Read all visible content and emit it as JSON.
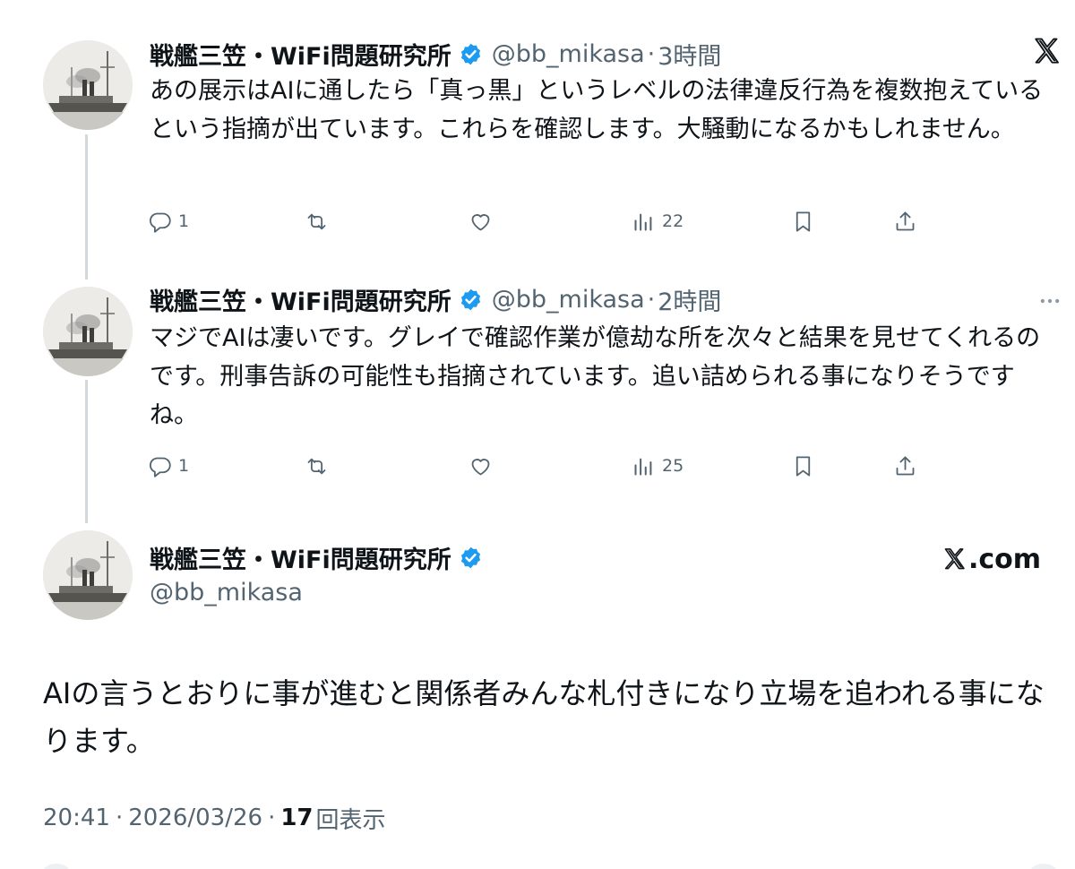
{
  "author": {
    "name": "戦艦三笠・WiFi問題研究所",
    "handle": "@bb_mikasa",
    "verified_color": "#1d9bf0"
  },
  "separator": "·",
  "tweets": [
    {
      "time": "3時間",
      "text": "あの展示はAIに通したら「真っ黒」というレベルの法律違反行為を複数抱えているという指摘が出ています。これらを確認します。大騒動になるかもしれません。",
      "replies": "1",
      "retweets": "",
      "likes": "",
      "views": "22",
      "corner_icon": "x-logo-icon"
    },
    {
      "time": "2時間",
      "text": "マジでAIは凄いです。グレイで確認作業が億劫な所を次々と結果を見せてくれるのです。刑事告訴の可能性も指摘されています。追い詰められる事になりそうですね。",
      "replies": "1",
      "retweets": "",
      "likes": "",
      "views": "25",
      "corner_icon": "more-icon"
    }
  ],
  "quoted": {
    "source_label": ".com",
    "text": "AIの言うとおりに事が進むと関係者みんな札付きになり立場を追われる事になります。",
    "time": "20:41",
    "date": "2026/03/26",
    "views_count": "17",
    "views_label": "回表示"
  },
  "colors": {
    "text_primary": "#0f1419",
    "text_secondary": "#536471",
    "thread_line": "#cfd9de",
    "verified": "#1d9bf0"
  }
}
